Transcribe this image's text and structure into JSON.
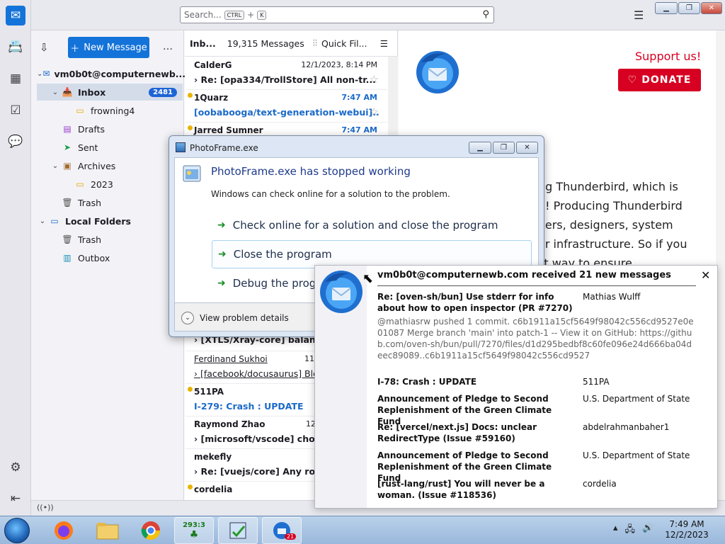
{
  "search": {
    "placeholder": "Search...",
    "key1": "CTRL",
    "plus": "+",
    "key2": "K"
  },
  "toolbar": {
    "new_message": "New Message"
  },
  "folders": [
    {
      "name": "vm0b0t@computernewb...",
      "kind": "account"
    },
    {
      "name": "Inbox",
      "badge": "2481",
      "kind": "inbox"
    },
    {
      "name": "frowning4",
      "kind": "folder"
    },
    {
      "name": "Drafts",
      "kind": "drafts"
    },
    {
      "name": "Sent",
      "kind": "sent"
    },
    {
      "name": "Archives",
      "kind": "archives"
    },
    {
      "name": "2023",
      "kind": "folder"
    },
    {
      "name": "Trash",
      "kind": "trash"
    },
    {
      "name": "Local Folders",
      "kind": "local"
    },
    {
      "name": "Trash",
      "kind": "trash"
    },
    {
      "name": "Outbox",
      "kind": "outbox"
    }
  ],
  "list_header": {
    "folder": "Inb...",
    "count": "19,315 Messages",
    "quick_filter": "Quick Fil..."
  },
  "messages": [
    {
      "from": "CalderG",
      "date": "12/1/2023, 8:14 PM",
      "subject": "Re: [opa334/TrollStore] All non-tr..."
    },
    {
      "from": "1Quarz",
      "date": "7:47 AM",
      "subject": "[oobabooga/text-generation-webui]..."
    },
    {
      "from": "Jarred Sumner",
      "date": "7:47 AM",
      "subject": ""
    },
    {
      "from": "",
      "date": "",
      "subject": "[XTLS/Xray-core] balance"
    },
    {
      "from": "Ferdinand Sukhoi",
      "date": "11/",
      "subject": "[facebook/docusaurus] Blo"
    },
    {
      "from": "511PA",
      "date": "",
      "subject": "I-279: Crash : UPDATE"
    },
    {
      "from": "Raymond Zhao",
      "date": "12",
      "subject": "[microsoft/vscode] chore"
    },
    {
      "from": "mekefly",
      "date": "",
      "subject": "Re: [vuejs/core] Any room"
    },
    {
      "from": "cordelia",
      "date": "",
      "subject": ""
    }
  ],
  "pane": {
    "support": "Support us!",
    "donate": "DONATE",
    "body_lines": [
      "ng Thunderbird, which is",
      "u! Producing Thunderbird",
      "eers, designers, system",
      "er infrastructure. So if you",
      "st way to ensure"
    ]
  },
  "dialog": {
    "title": "PhotoFrame.exe",
    "heading": "PhotoFrame.exe has stopped working",
    "sub": "Windows can check online for a solution to the problem.",
    "opt1": "Check online for a solution and close the program",
    "opt2": "Close the program",
    "opt3": "Debug the progra",
    "details": "View problem details"
  },
  "notification": {
    "title": "vm0b0t@computernewb.com received 21 new messages",
    "items": [
      {
        "subject": "Re: [oven-sh/bun] Use stderr for info about how to open inspector (PR #7270)",
        "author": "Mathias Wulff"
      },
      {
        "subject": "I-78: Crash : UPDATE",
        "author": "511PA"
      },
      {
        "subject": "Announcement of Pledge to Second Replenishment of the Green Climate Fund",
        "author": "U.S. Department of State"
      },
      {
        "subject": "Re: [vercel/next.js] Docs: unclear RedirectType (Issue #59160)",
        "author": "abdelrahmanbaher1"
      },
      {
        "subject": "Announcement of Pledge to Second Replenishment of the Green Climate Fund",
        "author": "U.S. Department of State"
      },
      {
        "subject": "[rust-lang/rust] You will never be a woman. (Issue #118536)",
        "author": "cordelia"
      }
    ],
    "preview": "@mathiasrw pushed 1 commit. c6b1911a15cf5649f98042c556cd9527e0e01087 Merge branch 'main' into patch-1 -- View it on GitHub: https://github.com/oven-sh/bun/pull/7270/files/d1d295bedbf8c60fe096e24d666ba04deec89089..c6b1911a15cf5649f98042c556cd9527"
  },
  "taskbar": {
    "counter": "293:3",
    "badge": "21",
    "time": "7:49 AM",
    "date": "12/2/2023"
  },
  "colors": {
    "accent": "#1373d9",
    "donate": "#d70022",
    "link": "#1b6ac9",
    "unread_dot": "#e8b400"
  }
}
